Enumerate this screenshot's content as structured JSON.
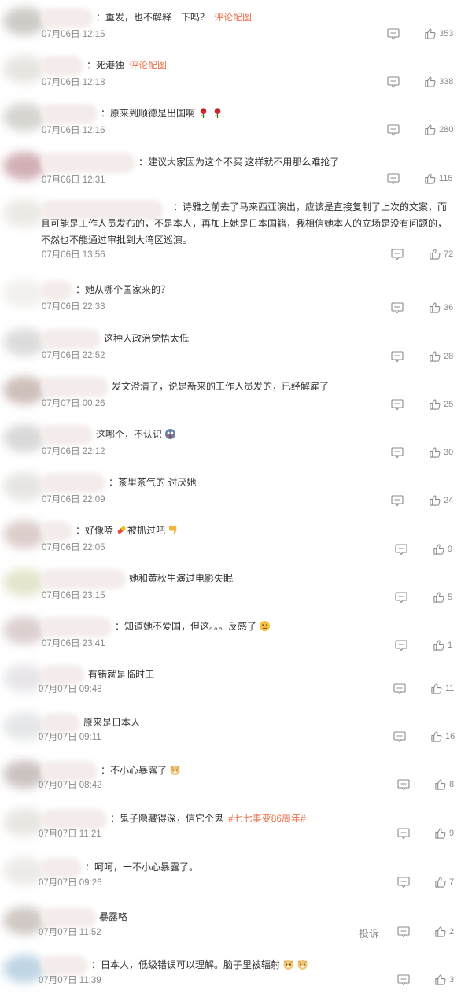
{
  "reply_icon": "comment-icon",
  "like_icon": "thumbs-up-icon",
  "report_label": "投诉",
  "comments": [
    {
      "text": "：重发，也不解释一下吗？",
      "link": "评论配图",
      "time": "07月06日 12:15",
      "likes": "353",
      "avatar": "#c9c6c1"
    },
    {
      "text": "：死港独",
      "link": "评论配图",
      "time": "07月06日 12:18",
      "likes": "338",
      "avatar": "#e6e3de"
    },
    {
      "text": "：原来到顺德是出国啊",
      "emojis": [
        "rose",
        "rose"
      ],
      "time": "07月06日 12:16",
      "likes": "280",
      "avatar": "#d2d1cc"
    },
    {
      "text": "：建议大家因为这个不买 这样就不用那么难抢了",
      "time": "07月06日 12:31",
      "likes": "115",
      "avatar": "#cda7ad"
    },
    {
      "text": "：诗雅之前去了马来西亚演出，应该是直接复制了上次的文案，而且可能是工作人员发布的，不是本人，再加上她是日本国籍，我相信她本人的立场是没有问题的，不然也不能通过审批到大湾区巡演。",
      "time": "07月06日 13:56",
      "likes": "72",
      "avatar": "#ebe7e3"
    },
    {
      "text": "：她从哪个国家来的？",
      "time": "07月06日 22:33",
      "likes": "36",
      "avatar": "#f1efec"
    },
    {
      "text": "这种人政治觉悟太低",
      "time": "07月06日 22:52",
      "likes": "28",
      "avatar": "#d9d9d9"
    },
    {
      "text": "发文澄清了，说是新来的工作人员发的，已经解雇了",
      "time": "07月07日 00:26",
      "likes": "25",
      "avatar": "#c8b9b3"
    },
    {
      "text": "这哪个，不认识",
      "emojis": [
        "surprised"
      ],
      "time": "07月06日 22:12",
      "likes": "30",
      "avatar": "#d5d5d5"
    },
    {
      "text": "：茶里茶气的 讨厌她",
      "time": "07月06日 22:09",
      "likes": "24",
      "avatar": "#e4e3df"
    },
    {
      "text": "：好像嗑",
      "emojis": [
        "pill"
      ],
      "text2": "被抓过吧",
      "emojis2": [
        "thumbs-down"
      ],
      "time": "07月06日 22:05",
      "likes": "9",
      "avatar": "#d8c9c6"
    },
    {
      "text": "她和黄秋生演过电影失眠",
      "time": "07月06日 23:15",
      "likes": "5",
      "avatar": "#e3e3c8"
    },
    {
      "text": "：知道她不爱国，但这。。。反感了",
      "emojis": [
        "thinking"
      ],
      "time": "07月06日 23:41",
      "likes": "1",
      "avatar": "#d8cccb"
    },
    {
      "text": "有错就是临时工",
      "time": "07月07日 09:48",
      "likes": "11",
      "avatar": "#e6e3e8"
    },
    {
      "text": "原来是日本人",
      "time": "07月07日 09:11",
      "likes": "16",
      "avatar": "#e2e4e6"
    },
    {
      "text": "：不小心暴露了",
      "emojis": [
        "doge"
      ],
      "time": "07月07日 08:42",
      "likes": "8",
      "avatar": "#c7bdbb"
    },
    {
      "text": "：鬼子隐藏得深，信它个鬼",
      "link": "#七七事变86周年#",
      "time": "07月07日 11:21",
      "likes": "9",
      "avatar": "#e6e4df"
    },
    {
      "text": "：呵呵，一不小心暴露了。",
      "time": "07月07日 09:26",
      "likes": "7",
      "avatar": "#ebe8e6"
    },
    {
      "text": "暴露咯",
      "time": "07月07日 11:52",
      "likes": "2",
      "avatar": "#cbc4bf"
    },
    {
      "text": "：日本人，低级错误可以理解。脑子里被辐射",
      "emojis": [
        "doge",
        "doge"
      ],
      "time": "07月07日 11:39",
      "likes": "3",
      "avatar": "#b9d1e2"
    }
  ]
}
